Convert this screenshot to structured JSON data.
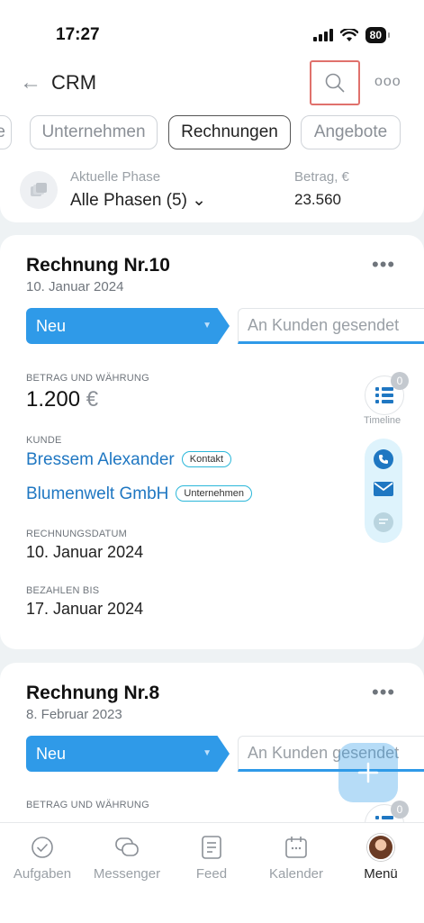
{
  "status": {
    "time": "17:27",
    "battery": "80"
  },
  "nav": {
    "back_label": "←",
    "title": "CRM",
    "more_label": "ooo"
  },
  "tabs": [
    {
      "label": "e"
    },
    {
      "label": "Unternehmen"
    },
    {
      "label": "Rechnungen",
      "active": true
    },
    {
      "label": "Angebote"
    }
  ],
  "phase": {
    "caption": "Aktuelle Phase",
    "value": "Alle Phasen (5) ⌄",
    "amount_caption": "Betrag, €",
    "amount_value": "23.560"
  },
  "invoices": [
    {
      "title": "Rechnung Nr.10",
      "date": "10. Januar 2024",
      "more": "•••",
      "stage": "Neu",
      "next_stage": "An Kunden gesendet",
      "amount_label": "BETRAG UND WÄHRUNG",
      "amount": "1.200",
      "currency": "€",
      "customer_label": "KUNDE",
      "contact_name": "Bressem Alexander",
      "contact_badge": "Kontakt",
      "company_name": "Blumenwelt GmbH",
      "company_badge": "Unternehmen",
      "invoice_date_label": "RECHNUNGSDATUM",
      "invoice_date": "10. Januar 2024",
      "due_label": "BEZAHLEN BIS",
      "due_date": "17. Januar 2024",
      "timeline_label": "Timeline",
      "timeline_count": "0"
    },
    {
      "title": "Rechnung Nr.8",
      "date": "8. Februar 2023",
      "more": "•••",
      "stage": "Neu",
      "next_stage": "An Kunden gesendet",
      "amount_label": "BETRAG UND WÄHRUNG",
      "timeline_count": "0"
    }
  ],
  "bottom_nav": [
    {
      "label": "Aufgaben",
      "icon": "check-circle-icon"
    },
    {
      "label": "Messenger",
      "icon": "chat-icon"
    },
    {
      "label": "Feed",
      "icon": "feed-icon"
    },
    {
      "label": "Kalender",
      "icon": "calendar-icon"
    },
    {
      "label": "Menü",
      "icon": "avatar",
      "active": true
    }
  ],
  "colors": {
    "accent": "#2f9ae8",
    "link": "#1f77c2",
    "highlight_border": "#e0716c"
  }
}
